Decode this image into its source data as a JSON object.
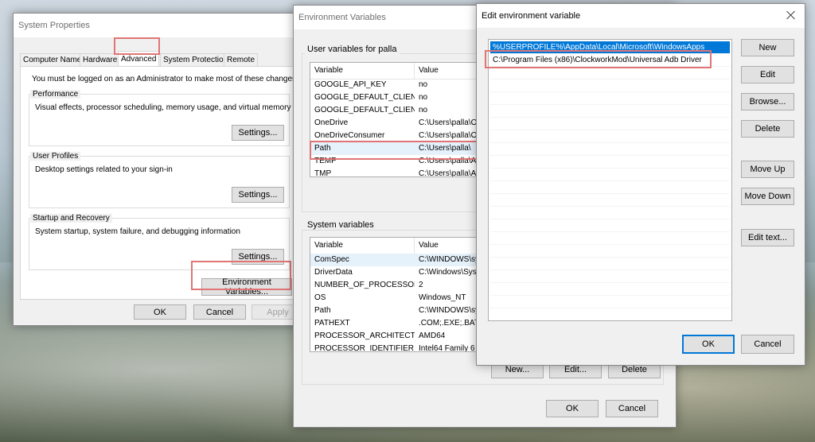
{
  "system_properties": {
    "title": "System Properties",
    "tabs": [
      "Computer Name",
      "Hardware",
      "Advanced",
      "System Protection",
      "Remote"
    ],
    "admin_note": "You must be logged on as an Administrator to make most of these changes.",
    "performance": {
      "label": "Performance",
      "desc": "Visual effects, processor scheduling, memory usage, and virtual memory",
      "button": "Settings..."
    },
    "user_profiles": {
      "label": "User Profiles",
      "desc": "Desktop settings related to your sign-in",
      "button": "Settings..."
    },
    "startup": {
      "label": "Startup and Recovery",
      "desc": "System startup, system failure, and debugging information",
      "button": "Settings..."
    },
    "env_button": "Environment Variables...",
    "ok": "OK",
    "cancel": "Cancel",
    "apply": "Apply"
  },
  "env_vars": {
    "title": "Environment Variables",
    "user_label": "User variables for palla",
    "columns": [
      "Variable",
      "Value"
    ],
    "user_rows": [
      {
        "var": "GOOGLE_API_KEY",
        "val": "no"
      },
      {
        "var": "GOOGLE_DEFAULT_CLIENT...",
        "val": "no"
      },
      {
        "var": "GOOGLE_DEFAULT_CLIENT...",
        "val": "no"
      },
      {
        "var": "OneDrive",
        "val": "C:\\Users\\palla\\O"
      },
      {
        "var": "OneDriveConsumer",
        "val": "C:\\Users\\palla\\O"
      },
      {
        "var": "Path",
        "val": "C:\\Users\\palla\\"
      },
      {
        "var": "TEMP",
        "val": "C:\\Users\\palla\\A"
      },
      {
        "var": "TMP",
        "val": "C:\\Users\\palla\\A"
      }
    ],
    "system_label": "System variables",
    "system_rows": [
      {
        "var": "ComSpec",
        "val": "C:\\WINDOWS\\sy"
      },
      {
        "var": "DriverData",
        "val": "C:\\Windows\\Sys"
      },
      {
        "var": "NUMBER_OF_PROCESSORS",
        "val": "2"
      },
      {
        "var": "OS",
        "val": "Windows_NT"
      },
      {
        "var": "Path",
        "val": "C:\\WINDOWS\\sy"
      },
      {
        "var": "PATHEXT",
        "val": ".COM;.EXE;.BAT;."
      },
      {
        "var": "PROCESSOR_ARCHITECTU...",
        "val": "AMD64"
      },
      {
        "var": "PROCESSOR_IDENTIFIER",
        "val": "Intel64 Family 6"
      }
    ],
    "new": "New...",
    "edit": "Edit...",
    "delete": "Delete",
    "ok": "OK",
    "cancel": "Cancel"
  },
  "edit_env": {
    "title": "Edit environment variable",
    "entries": [
      "%USERPROFILE%\\AppData\\Local\\Microsoft\\WindowsApps",
      "C:\\Program Files (x86)\\ClockworkMod\\Universal Adb Driver"
    ],
    "buttons": {
      "new": "New",
      "edit": "Edit",
      "browse": "Browse...",
      "delete": "Delete",
      "move_up": "Move Up",
      "move_down": "Move Down",
      "edit_text": "Edit text..."
    },
    "ok": "OK",
    "cancel": "Cancel"
  }
}
